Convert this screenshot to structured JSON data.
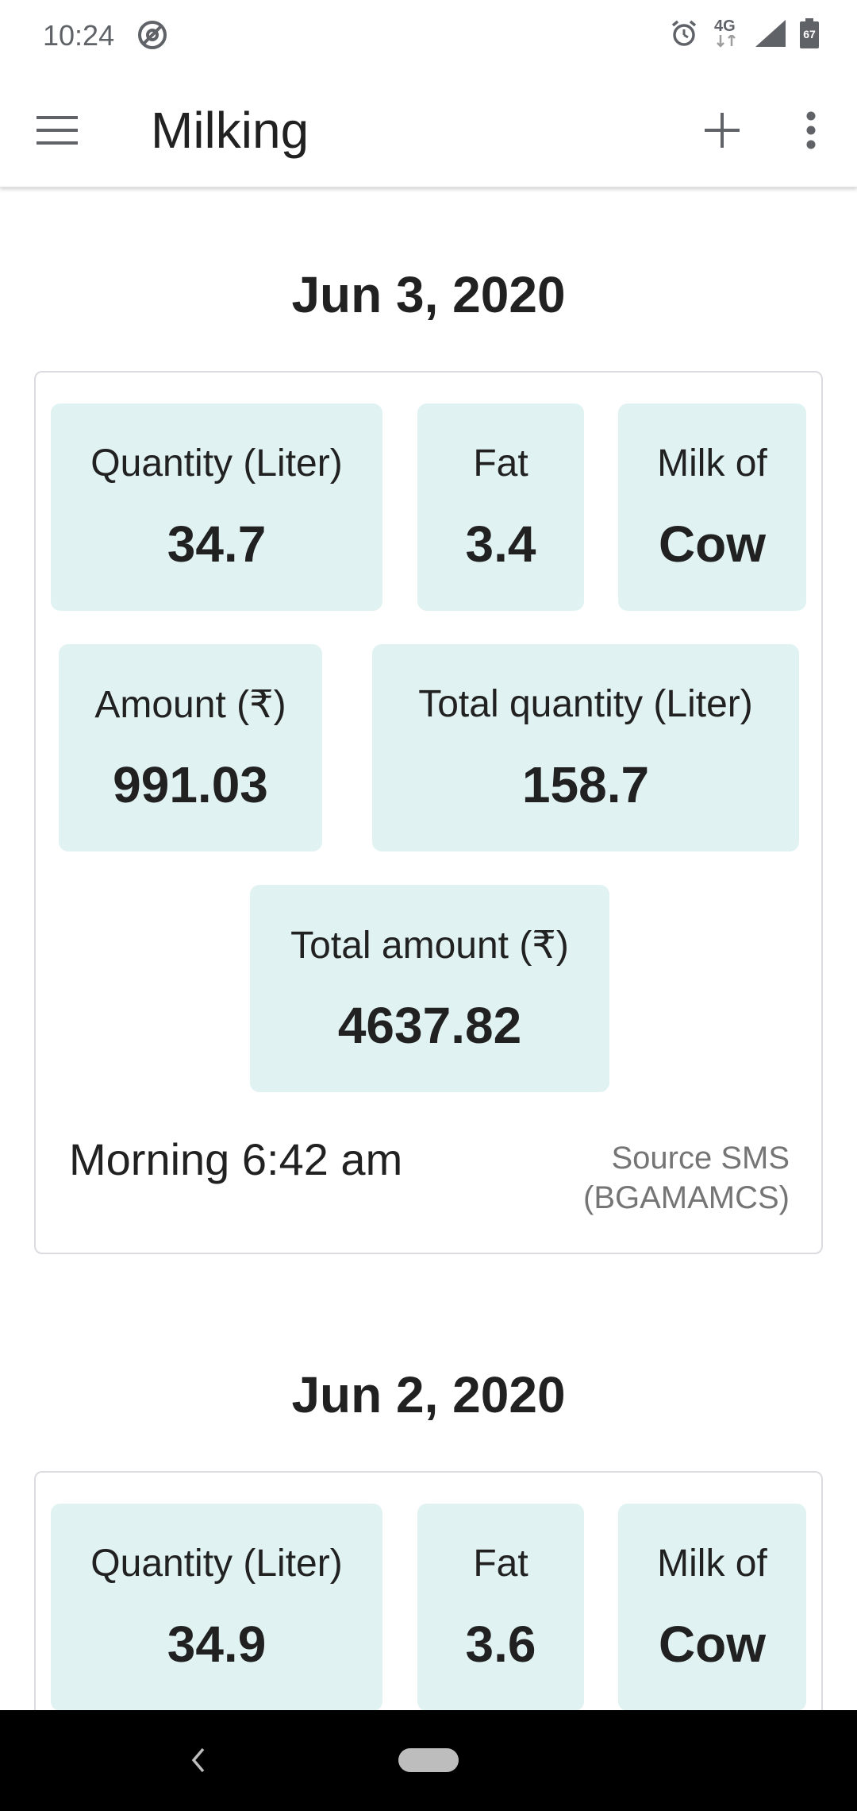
{
  "status_bar": {
    "time": "10:24",
    "network_label": "4G",
    "battery_level": "67",
    "icons": [
      "at-sign-icon",
      "alarm-icon",
      "network-4g-icon",
      "signal-icon",
      "battery-icon"
    ]
  },
  "app_bar": {
    "title": "Milking",
    "icons": [
      "hamburger-menu-icon",
      "add-icon",
      "more-vert-icon"
    ]
  },
  "days": [
    {
      "date": "Jun 3, 2020",
      "tiles": [
        {
          "label": "Quantity (Liter)",
          "value": "34.7"
        },
        {
          "label": "Fat",
          "value": "3.4"
        },
        {
          "label": "Milk of",
          "value": "Cow"
        },
        {
          "label": "Amount (₹)",
          "value": "991.03"
        },
        {
          "label": "Total quantity (Liter)",
          "value": "158.7"
        },
        {
          "label": "Total amount (₹)",
          "value": "4637.82"
        }
      ],
      "session_time": "Morning 6:42 am",
      "source": "Source SMS (BGAMAMCS)"
    },
    {
      "date": "Jun 2, 2020",
      "tiles": [
        {
          "label": "Quantity (Liter)",
          "value": "34.9"
        },
        {
          "label": "Fat",
          "value": "3.6"
        },
        {
          "label": "Milk of",
          "value": "Cow"
        }
      ]
    }
  ],
  "colors": {
    "tile_background": "#e0f2f1",
    "card_border": "#dadce0",
    "text_primary": "#212121",
    "text_secondary": "#757575",
    "nav_bar": "#000000"
  },
  "nav_bar": {
    "icons": [
      "back-icon",
      "home-pill-icon"
    ]
  }
}
